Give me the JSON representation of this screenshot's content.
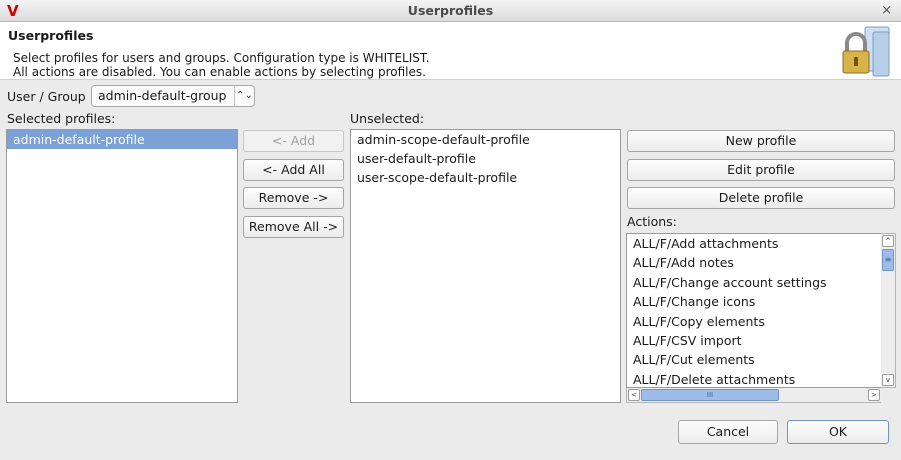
{
  "window": {
    "logo": "V",
    "title": "Userprofiles",
    "close_glyph": "×"
  },
  "header": {
    "title": "Userprofiles",
    "line1": "Select profiles for users and groups. Configuration type is WHITELIST.",
    "line2": "All actions are disabled. You can enable actions by selecting profiles.",
    "icon": "padlock-icon"
  },
  "user_group": {
    "label": "User / Group",
    "selected": "admin-default-group",
    "arrows_glyph": "⌃⌄"
  },
  "selected_profiles": {
    "label": "Selected profiles:",
    "items": [
      "admin-default-profile"
    ]
  },
  "transfer_buttons": {
    "add": "<- Add",
    "add_all": "<- Add All",
    "remove": "Remove ->",
    "remove_all": "Remove All ->"
  },
  "unselected": {
    "label": "Unselected:",
    "items": [
      "admin-scope-default-profile",
      "user-default-profile",
      "user-scope-default-profile"
    ]
  },
  "profile_buttons": {
    "new": "New profile",
    "edit": "Edit profile",
    "delete": "Delete profile"
  },
  "actions": {
    "label": "Actions:",
    "items": [
      "ALL/F/Add attachments",
      "ALL/F/Add notes",
      "ALL/F/Change account settings",
      "ALL/F/Change icons",
      "ALL/F/Copy elements",
      "ALL/F/CSV import",
      "ALL/F/Cut elements",
      "ALL/F/Delete attachments"
    ],
    "hscroll_thumb_glyph": "III",
    "vscroll_thumb_glyph": "≡",
    "arrow_left": "<",
    "arrow_right": ">",
    "arrow_up": "^",
    "arrow_down": "v"
  },
  "footer": {
    "cancel": "Cancel",
    "ok": "OK"
  },
  "colors": {
    "selection": "#7ca1d6",
    "logo": "#d40000",
    "scroll_thumb": "#9dbde8"
  }
}
